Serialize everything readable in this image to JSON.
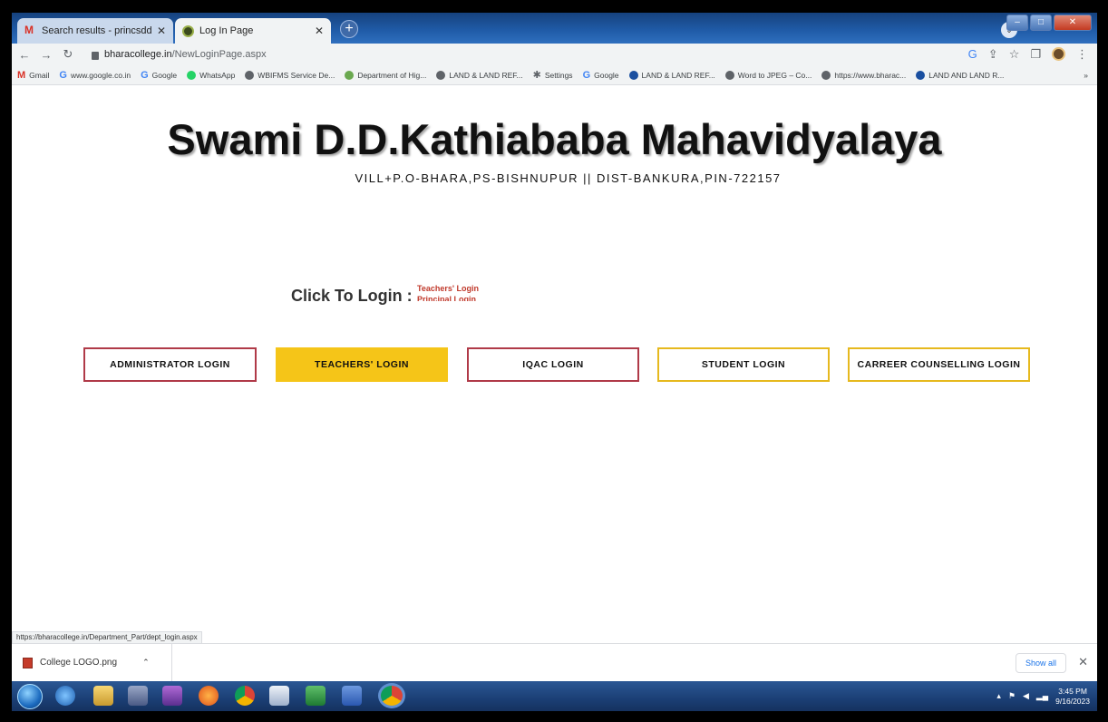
{
  "browser": {
    "tabs": [
      {
        "label": "Search results - princsddkm@gm",
        "active": false
      },
      {
        "label": "Log In Page",
        "active": true
      }
    ],
    "url_domain": "bharacollege.in",
    "url_path": "/NewLoginPage.aspx",
    "bookmarks": [
      {
        "label": "Gmail",
        "icon": "gmail-icon"
      },
      {
        "label": "www.google.co.in",
        "icon": "google-icon"
      },
      {
        "label": "Google",
        "icon": "google-icon"
      },
      {
        "label": "WhatsApp",
        "icon": "whatsapp-icon"
      },
      {
        "label": "WBIFMS Service De...",
        "icon": "globe-icon"
      },
      {
        "label": "Department of Hig...",
        "icon": "emblem-icon"
      },
      {
        "label": "LAND & LAND REF...",
        "icon": "globe-icon"
      },
      {
        "label": "Settings",
        "icon": "gear-icon"
      },
      {
        "label": "Google",
        "icon": "google-icon"
      },
      {
        "label": "LAND & LAND REF...",
        "icon": "site-icon"
      },
      {
        "label": "Word to JPEG – Co...",
        "icon": "globe-icon"
      },
      {
        "label": "https://www.bharac...",
        "icon": "globe-icon"
      },
      {
        "label": "LAND AND LAND R...",
        "icon": "site-icon"
      }
    ],
    "bookmarks_more": "»"
  },
  "page": {
    "title": "Swami D.D.Kathiababa Mahavidyalaya",
    "subtitle": "VILL+P.O-BHARA,PS-BISHNUPUR || DIST-BANKURA,PIN-722157",
    "click_label": "Click To Login :",
    "marquee_items": [
      "Teachers' Login",
      "Principal Login"
    ],
    "login_buttons": [
      {
        "label": "ADMINISTRATOR LOGIN"
      },
      {
        "label": "TEACHERS' LOGIN"
      },
      {
        "label": "IQAC LOGIN"
      },
      {
        "label": "STUDENT LOGIN"
      },
      {
        "label": "CARREER COUNSELLING LOGIN"
      }
    ]
  },
  "status_url": "https://bharacollege.in/Department_Part/dept_login.aspx",
  "download_bar": {
    "file_name": "College LOGO.png",
    "show_all": "Show all"
  },
  "taskbar": {
    "time": "3:45 PM",
    "date": "9/16/2023"
  },
  "colors": {
    "teachers_button": "#f5c518",
    "red_border": "#b03a48",
    "yellow_border": "#e6b91e",
    "marquee_text": "#c0392b"
  }
}
